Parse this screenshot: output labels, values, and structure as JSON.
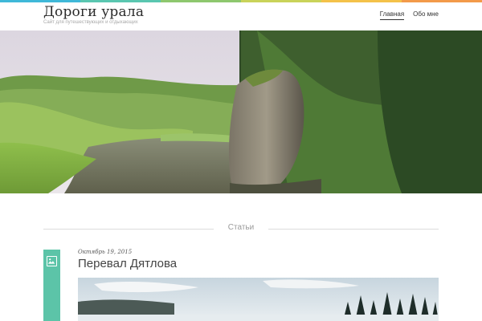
{
  "site": {
    "title": "Дороги урала",
    "description": "Сайт для путешествующих и отдыхающих"
  },
  "top_bar_colors": [
    "#3fb8d8",
    "#5ac6b0",
    "#8ec76e",
    "#c9d35a",
    "#f4c24a",
    "#f39a4a"
  ],
  "nav": {
    "items": [
      {
        "label": "Главная",
        "active": true
      },
      {
        "label": "Обо мне",
        "active": false
      }
    ]
  },
  "hero": {
    "icon": "landscape-river-cliff-photo"
  },
  "section": {
    "title": "Статьи"
  },
  "posts": [
    {
      "date": "Октябрь 19, 2015",
      "title": "Перевал Дятлова",
      "format_icon": "image-icon",
      "accent": "#5cc4a8"
    }
  ]
}
